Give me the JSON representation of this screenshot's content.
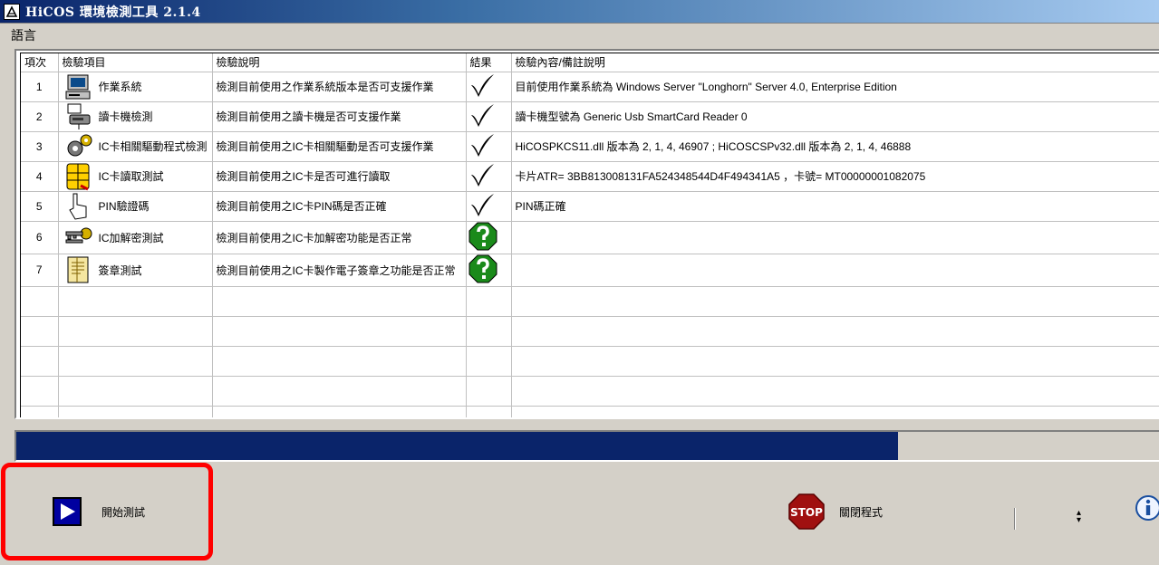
{
  "window": {
    "title": "HiCOS 環境檢測工具 2.1.4"
  },
  "menu": {
    "language": "語言"
  },
  "grid": {
    "columns": [
      "項次",
      "檢驗項目",
      "檢驗說明",
      "結果",
      "檢驗內容/備註說明"
    ],
    "rows": [
      {
        "no": "1",
        "item": "作業系統",
        "desc": "檢測目前使用之作業系統版本是否可支援作業",
        "result": "pass",
        "note": "目前使用作業系統為 Windows Server \"Longhorn\" Server 4.0, Enterprise Edition",
        "icon": "computer-icon"
      },
      {
        "no": "2",
        "item": "讀卡機檢測",
        "desc": "檢測目前使用之讀卡機是否可支援作業",
        "result": "pass",
        "note": "讀卡機型號為  Generic Usb SmartCard Reader 0",
        "icon": "card-reader-icon"
      },
      {
        "no": "3",
        "item": "IC卡相關驅動程式檢測",
        "desc": "檢測目前使用之IC卡相關驅動是否可支援作業",
        "result": "pass",
        "note": "HiCOSPKCS11.dll 版本為 2, 1, 4, 46907 ; HiCOSCSPv32.dll 版本為 2, 1, 4, 46888",
        "icon": "gears-icon"
      },
      {
        "no": "4",
        "item": "IC卡讀取測試",
        "desc": "檢測目前使用之IC卡是否可進行讀取",
        "result": "pass",
        "note": "卡片ATR= 3BB813008131FA524348544D4F494341A5 ，卡號= MT00000001082075",
        "icon": "smartcard-chip-icon"
      },
      {
        "no": "5",
        "item": "PIN驗證碼",
        "desc": "檢測目前使用之IC卡PIN碼是否正確",
        "result": "pass",
        "note": "PIN碼正確",
        "icon": "hand-pointer-icon"
      },
      {
        "no": "6",
        "item": "IC加解密測試",
        "desc": "檢測目前使用之IC卡加解密功能是否正常",
        "result": "unknown",
        "note": "",
        "icon": "keys-icon"
      },
      {
        "no": "7",
        "item": "簽章測試",
        "desc": "檢測目前使用之IC卡製作電子簽章之功能是否正常",
        "result": "unknown",
        "note": "",
        "icon": "document-icon"
      }
    ],
    "empty_rows": 5
  },
  "progress": {
    "fraction": 0.772,
    "color": "#0a246a"
  },
  "buttons": {
    "start_label": "開始測試",
    "close_label": "關閉程式",
    "stop_icon_text": "STOP"
  },
  "colors": {
    "highlight": "#ff0000",
    "question_green": "#1a8a1a",
    "stop_red": "#a01010"
  }
}
